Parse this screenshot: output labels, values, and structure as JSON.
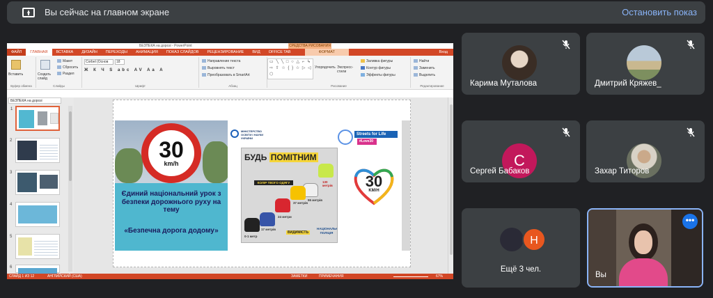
{
  "topbar": {
    "status": "Вы сейчас на главном экране",
    "stop_label": "Остановить показ"
  },
  "ppt": {
    "doc_title": "БЕЗПЕКА на дорозі - PowerPoint",
    "drawing_tools": "СРЕДСТВА РИСОВАНИЯ",
    "tabs": [
      "ФАЙЛ",
      "ГЛАВНАЯ",
      "ВСТАВКА",
      "ДИЗАЙН",
      "ПЕРЕХОДЫ",
      "АНИМАЦИЯ",
      "ПОКАЗ СЛАЙДОВ",
      "РЕЦЕНЗИРОВАНИЕ",
      "ВИД",
      "OFFICE TAB"
    ],
    "format_tab": "ФОРМАТ",
    "signin": "Вход",
    "ribbon": {
      "paste": "Вставить",
      "create_slide": "Создать слайд",
      "layout": "Макет",
      "reset": "Сбросить",
      "section": "Раздел",
      "clipboard": "Буфер обмена",
      "slides": "Слайды",
      "font_name": "Corbel (Основ",
      "font_size": "18",
      "font_group": "Шрифт",
      "text_dir": "Направление текста",
      "align_text": "Выровнять текст",
      "smartart": "Преобразовать в SmartArt",
      "paragraph": "Абзац",
      "arrange": "Упорядочить",
      "express_styles": "Экспресс-стили",
      "fill": "Заливка фигуры",
      "outline": "Контур фигуры",
      "effects": "Эффекты фигуры",
      "drawing": "Рисование",
      "find": "Найти",
      "replace": "Заменить",
      "select": "Выделить",
      "editing": "Редактирование"
    },
    "file_tab": "БЕЗПЕКА на дорозі",
    "slide_numbers": [
      "1",
      "2",
      "3",
      "4",
      "5",
      "6"
    ],
    "statusbar": {
      "slide": "СЛАЙД 1 ИЗ 12",
      "lang": "АНГЛИЙСКИЙ (США)",
      "notes": "ЗАМЕТКИ",
      "comments": "ПРИМЕЧАНИЯ",
      "zoom": "67%"
    }
  },
  "slide": {
    "sign_number": "30",
    "sign_unit": "km/h",
    "lesson_text": "Єдиний національний урок з безпеки дорожнього руху на тему",
    "lesson_topic": "«Безпечна дорога додому»",
    "ministry": "МІНІСТЕРСТВО ОСВІТИ І НАУКИ УКРАЇНИ",
    "poster_title_1": "БУДЬ ",
    "poster_title_2": "ПОМІТНИМ",
    "poster_stripe": "КОЛІР ТВОГО ОДЯГУ",
    "dist": [
      "0-1 метр",
      "17 метрів",
      "24 метри",
      "37 метрів",
      "55 метрів",
      "130 метрів"
    ],
    "visibility": "ВИДИМІСТЬ",
    "police": "НАЦІОНАЛЬНА ПОЛІЦІЯ",
    "sfl": "Streets for Life",
    "love30": "#Love30",
    "heart_number": "30",
    "heart_unit": "KM/H"
  },
  "participants": [
    {
      "name": "Карима Муталова"
    },
    {
      "name": "Дмитрий Кряжев_"
    },
    {
      "name": "Сергей Бабаков",
      "initial": "С"
    },
    {
      "name": "Захар Титоров"
    },
    {
      "more": "Ещё 3 чел.",
      "initial": "Н"
    },
    {
      "name": "Вы"
    }
  ],
  "colors": {
    "background": "#202124",
    "tile": "#3c4043",
    "accent": "#8ab4f8",
    "ppt_red": "#d24726",
    "avatar_s": "#c2185b",
    "avatar_n": "#e8571f"
  }
}
